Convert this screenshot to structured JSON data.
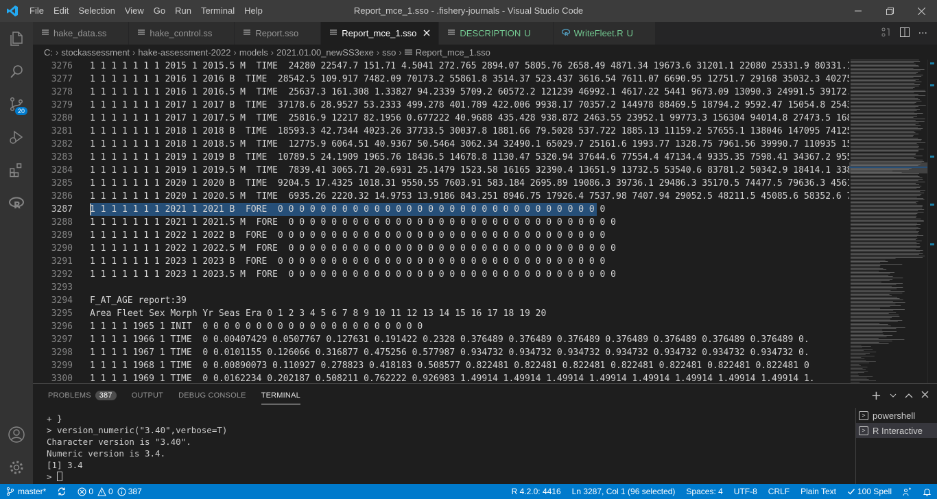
{
  "titlebar": {
    "menu": [
      "File",
      "Edit",
      "Selection",
      "View",
      "Go",
      "Run",
      "Terminal",
      "Help"
    ],
    "title": "Report_mce_1.sso - .fishery-journals - Visual Studio Code"
  },
  "activitybar": {
    "items": [
      "explorer-icon",
      "search-icon",
      "source-control-icon",
      "run-debug-icon",
      "extensions-icon",
      "r-icon"
    ],
    "scm_badge": "20",
    "bottom": [
      "account-icon",
      "manage-gear-icon"
    ]
  },
  "tabs": [
    {
      "label": "hake_data.ss",
      "active": false,
      "git": ""
    },
    {
      "label": "hake_control.ss",
      "active": false,
      "git": ""
    },
    {
      "label": "Report.sso",
      "active": false,
      "git": ""
    },
    {
      "label": "Report_mce_1.sso",
      "active": true,
      "git": ""
    },
    {
      "label": "DESCRIPTION",
      "active": false,
      "git": "U"
    },
    {
      "label": "WriteFleet.R",
      "active": false,
      "git": "U"
    }
  ],
  "breadcrumb": [
    "C:",
    "stockassessment",
    "hake-assessment-2022",
    "models",
    "2021.01.00_newSS3exe",
    "sso",
    "Report_mce_1.sso"
  ],
  "editor": {
    "current_line": 3287,
    "lines": [
      {
        "n": "3276",
        "t": "1 1 1 1 1 1 1 2015 1 2015.5 M  TIME  24280 22547.7 151.71 4.5041 272.765 2894.07 5805.76 2658.49 4871.34 19673.6 31201.1 22080 25331.9 80331.1"
      },
      {
        "n": "3277",
        "t": "1 1 1 1 1 1 1 2016 1 2016 B  TIME  28542.5 109.917 7482.09 70173.2 55861.8 3514.37 523.437 3616.54 7611.07 6690.95 12751.7 29168 35032.3 40275."
      },
      {
        "n": "3278",
        "t": "1 1 1 1 1 1 1 2016 1 2016.5 M  TIME  25637.3 161.308 1.33827 94.2339 5709.2 60572.2 121239 46992.1 4617.22 5441 9673.09 13090.3 24991.5 39172.7"
      },
      {
        "n": "3279",
        "t": "1 1 1 1 1 1 1 2017 1 2017 B  TIME  37178.6 28.9527 53.2333 499.278 401.789 422.006 9938.17 70357.2 144978 88469.5 18794.2 9592.47 15054.8 25434"
      },
      {
        "n": "3280",
        "t": "1 1 1 1 1 1 1 2017 1 2017.5 M  TIME  25816.9 12217 82.1956 0.677222 40.9688 435.428 938.872 2463.55 23952.1 99773.3 156304 94014.8 27473.5 1687"
      },
      {
        "n": "3281",
        "t": "1 1 1 1 1 1 1 2018 1 2018 B  TIME  18593.3 42.7344 4023.26 37733.5 30037.8 1881.66 79.5028 537.722 1885.13 11159.2 57655.1 138046 147095 74125."
      },
      {
        "n": "3282",
        "t": "1 1 1 1 1 1 1 2018 1 2018.5 M  TIME  12775.9 6064.51 40.9367 50.5464 3062.34 32490.1 65029.7 25161.6 1993.77 1328.75 7961.56 39990.7 110935 154"
      },
      {
        "n": "3283",
        "t": "1 1 1 1 1 1 1 2019 1 2019 B  TIME  10789.5 24.1909 1965.76 18436.5 14678.8 1130.47 5320.94 37644.6 77554.4 47134.4 9335.35 7598.41 34367.2 9552"
      },
      {
        "n": "3284",
        "t": "1 1 1 1 1 1 1 2019 1 2019.5 M  TIME  7839.41 3065.71 20.6931 25.1479 1523.58 16165 32390.4 13651.9 13732.5 53540.6 83781.2 50342.9 18414.1 3387"
      },
      {
        "n": "3285",
        "t": "1 1 1 1 1 1 1 2020 1 2020 B  TIME  9204.5 17.4325 1018.31 9550.55 7603.91 583.184 2695.89 19086.3 39736.1 29486.3 35170.5 74477.5 79636.3 45618"
      },
      {
        "n": "3286",
        "t": "1 1 1 1 1 1 1 2020 1 2020.5 M  TIME  6935.26 2220.32 14.9753 13.9186 843.251 8946.75 17926.4 7537.98 7407.94 29052.5 48211.5 45085.6 58352.6 74"
      },
      {
        "n": "3287",
        "t": "1 1 1 1 1 1 1 2021 1 2021 B  FORE  0 0 0 0 0 0 0 0 0 0 0 0 0 0 0 0 0 0 0 0 0 0 0 0 0 0 0 0 0 0 0"
      },
      {
        "n": "3288",
        "t": "1 1 1 1 1 1 1 2021 1 2021.5 M  FORE  0 0 0 0 0 0 0 0 0 0 0 0 0 0 0 0 0 0 0 0 0 0 0 0 0 0 0 0 0 0 0"
      },
      {
        "n": "3289",
        "t": "1 1 1 1 1 1 1 2022 1 2022 B  FORE  0 0 0 0 0 0 0 0 0 0 0 0 0 0 0 0 0 0 0 0 0 0 0 0 0 0 0 0 0 0 0"
      },
      {
        "n": "3290",
        "t": "1 1 1 1 1 1 1 2022 1 2022.5 M  FORE  0 0 0 0 0 0 0 0 0 0 0 0 0 0 0 0 0 0 0 0 0 0 0 0 0 0 0 0 0 0 0"
      },
      {
        "n": "3291",
        "t": "1 1 1 1 1 1 1 2023 1 2023 B  FORE  0 0 0 0 0 0 0 0 0 0 0 0 0 0 0 0 0 0 0 0 0 0 0 0 0 0 0 0 0 0 0"
      },
      {
        "n": "3292",
        "t": "1 1 1 1 1 1 1 2023 1 2023.5 M  FORE  0 0 0 0 0 0 0 0 0 0 0 0 0 0 0 0 0 0 0 0 0 0 0 0 0 0 0 0 0 0 0"
      },
      {
        "n": "3293",
        "t": ""
      },
      {
        "n": "3294",
        "t": "F_AT_AGE report:39"
      },
      {
        "n": "3295",
        "t": "Area Fleet Sex Morph Yr Seas Era 0 1 2 3 4 5 6 7 8 9 10 11 12 13 14 15 16 17 18 19 20"
      },
      {
        "n": "3296",
        "t": "1 1 1 1 1965 1 INIT  0 0 0 0 0 0 0 0 0 0 0 0 0 0 0 0 0 0 0 0 0"
      },
      {
        "n": "3297",
        "t": "1 1 1 1 1966 1 TIME  0 0.00407429 0.0507767 0.127631 0.191422 0.2328 0.376489 0.376489 0.376489 0.376489 0.376489 0.376489 0.376489 0."
      },
      {
        "n": "3298",
        "t": "1 1 1 1 1967 1 TIME  0 0.0101155 0.126066 0.316877 0.475256 0.577987 0.934732 0.934732 0.934732 0.934732 0.934732 0.934732 0.934732 0."
      },
      {
        "n": "3299",
        "t": "1 1 1 1 1968 1 TIME  0 0.00890073 0.110927 0.278823 0.418183 0.508577 0.822481 0.822481 0.822481 0.822481 0.822481 0.822481 0.822481 0"
      },
      {
        "n": "3300",
        "t": "1 1 1 1 1969 1 TIME  0 0.0162234 0.202187 0.508211 0.762222 0.926983 1.49914 1.49914 1.49914 1.49914 1.49914 1.49914 1.49914 1.49914 1."
      }
    ]
  },
  "panel": {
    "tabs": [
      {
        "label": "PROBLEMS",
        "count": "387",
        "active": false
      },
      {
        "label": "OUTPUT",
        "count": "",
        "active": false
      },
      {
        "label": "DEBUG CONSOLE",
        "count": "",
        "active": false
      },
      {
        "label": "TERMINAL",
        "count": "",
        "active": true
      }
    ],
    "terminal_lines": [
      "+ }",
      "> version_numeric(\"3.40\",verbose=T)",
      "Character version is \"3.40\".",
      "Numeric version is 3.4.",
      "[1] 3.4",
      "> "
    ],
    "terminals": [
      {
        "label": "powershell",
        "active": false
      },
      {
        "label": "R Interactive",
        "active": true
      }
    ]
  },
  "statusbar": {
    "branch": "master*",
    "errors": "0",
    "warnings": "0",
    "infos": "387",
    "r_version": "R 4.2.0: 4416",
    "position": "Ln 3287, Col 1 (96 selected)",
    "spaces": "Spaces: 4",
    "encoding": "UTF-8",
    "eol": "CRLF",
    "language": "Plain Text",
    "spell": "100 Spell"
  },
  "colors": {
    "accent": "#007acc",
    "selection": "#264f78",
    "git_untracked": "#73c991"
  }
}
